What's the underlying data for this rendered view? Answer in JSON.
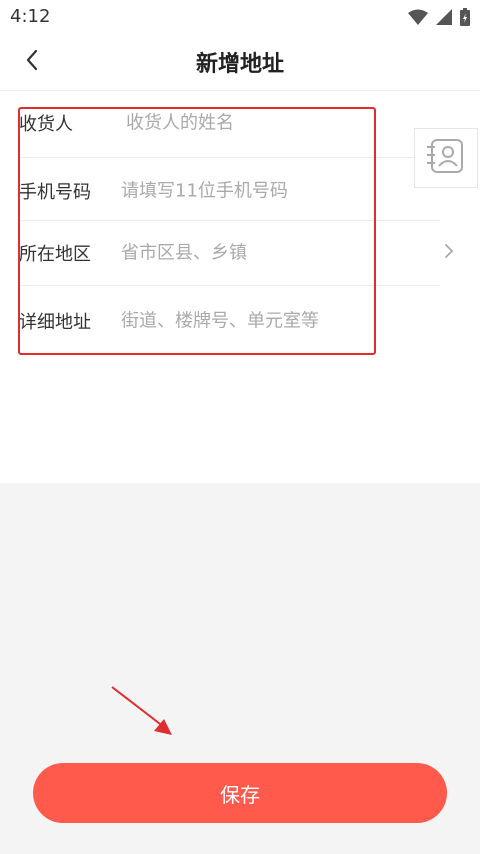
{
  "status_bar": {
    "time": "4:12",
    "icons": [
      "wifi-icon",
      "signal-icon",
      "battery-charging-icon"
    ]
  },
  "header": {
    "title": "新增地址",
    "back_icon": "chevron-left-icon"
  },
  "form": {
    "recipient": {
      "label": "收货人",
      "placeholder": "收货人的姓名",
      "value": ""
    },
    "phone": {
      "label": "手机号码",
      "placeholder": "请填写11位手机号码",
      "value": ""
    },
    "region": {
      "label": "所在地区",
      "placeholder": "省市区县、乡镇",
      "value": ""
    },
    "detail": {
      "label": "详细地址",
      "placeholder": "街道、楼牌号、单元室等",
      "value": ""
    }
  },
  "contact_picker": {
    "icon": "contact-book-icon"
  },
  "annotations": {
    "highlight_color": "#e02d2d",
    "arrow_color": "#e02d2d"
  },
  "save": {
    "label": "保存",
    "color": "#ff5a4b"
  }
}
